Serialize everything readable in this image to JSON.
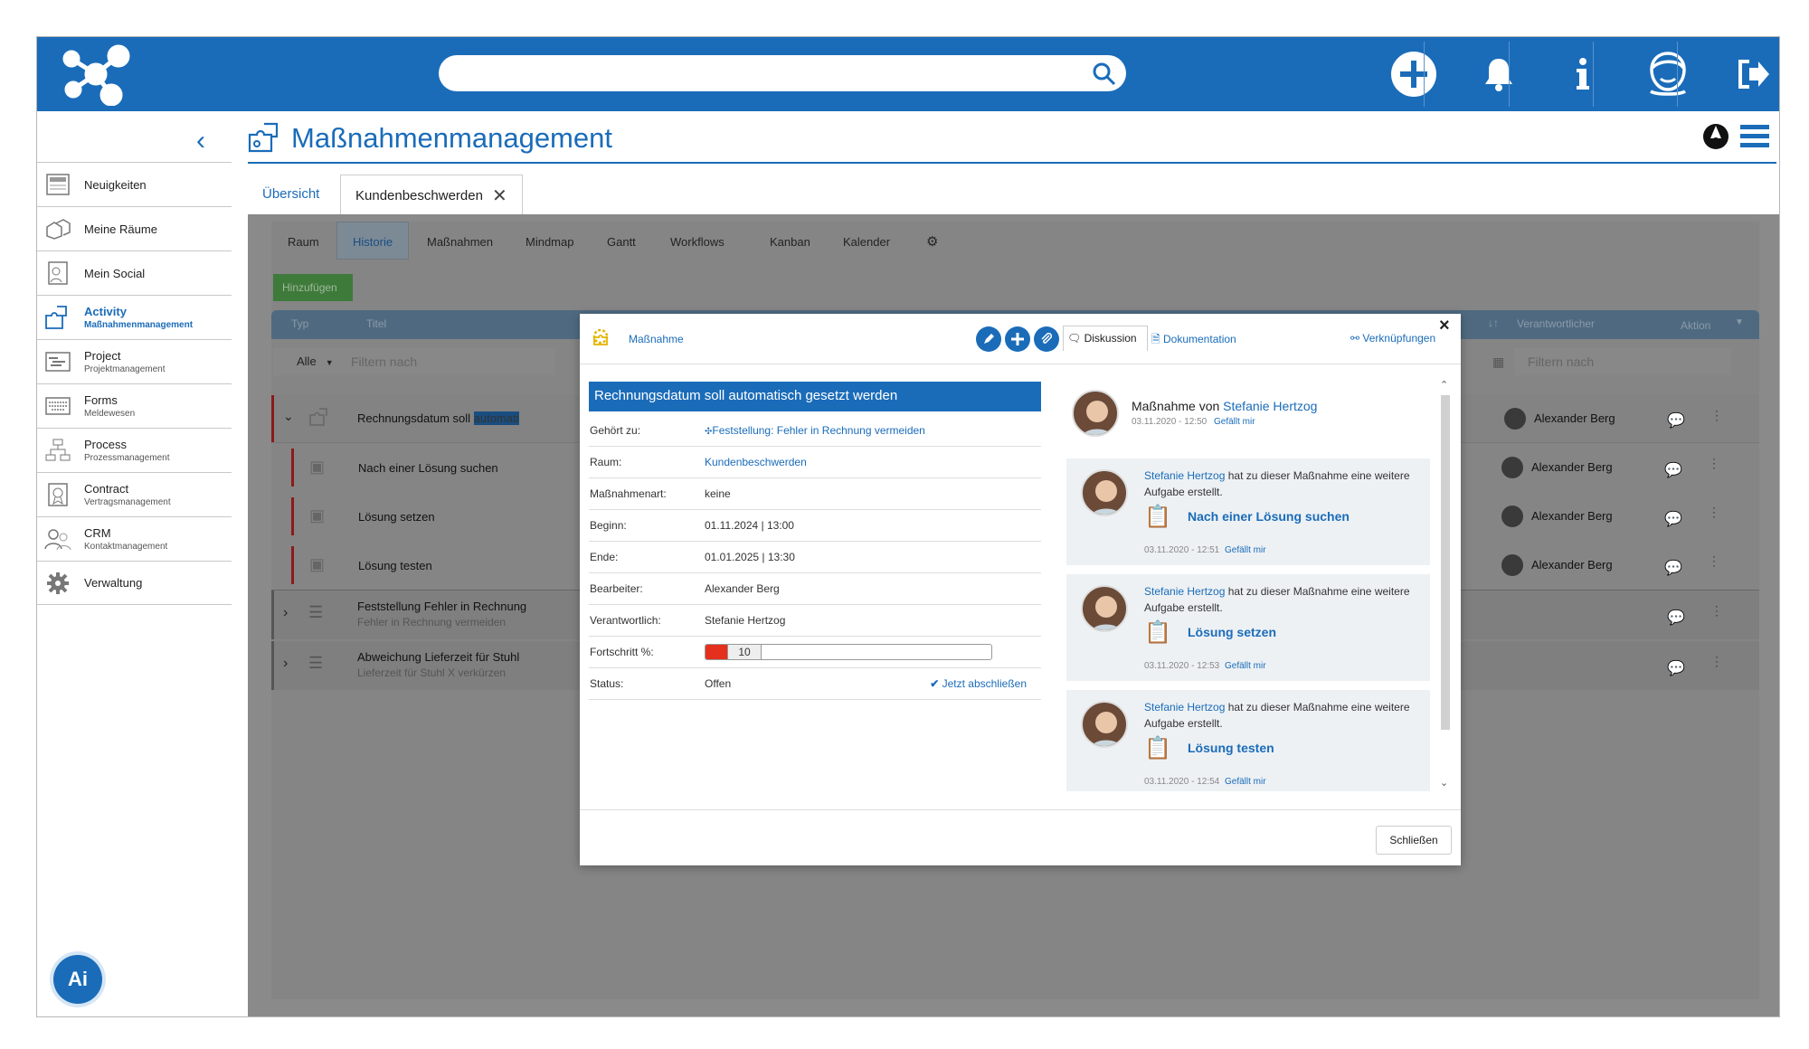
{
  "header": {
    "title": "Maßnahmenmanagement"
  },
  "sidebar": {
    "items": [
      {
        "label": "Neuigkeiten",
        "sub": ""
      },
      {
        "label": "Meine Räume",
        "sub": ""
      },
      {
        "label": "Mein Social",
        "sub": ""
      },
      {
        "label": "Activity",
        "sub": "Maßnahmenmanagement"
      },
      {
        "label": "Project",
        "sub": "Projektmanagement"
      },
      {
        "label": "Forms",
        "sub": "Meldewesen"
      },
      {
        "label": "Process",
        "sub": "Prozessmanagement"
      },
      {
        "label": "Contract",
        "sub": "Vertragsmanagement"
      },
      {
        "label": "CRM",
        "sub": "Kontaktmanagement"
      },
      {
        "label": "Verwaltung",
        "sub": ""
      }
    ],
    "ai_label": "Ai"
  },
  "tabs": {
    "overview": "Übersicht",
    "current": "Kundenbeschwerden"
  },
  "subtabs": [
    "Raum",
    "Historie",
    "Maßnahmen",
    "Mindmap",
    "Gantt",
    "Workflows",
    "Kanban",
    "Kalender"
  ],
  "table": {
    "add_button": "Hinzufügen",
    "col_type": "Typ",
    "col_title": "Titel",
    "col_responsible": "Verantwortlicher",
    "col_action": "Aktion",
    "filter_all": "Alle",
    "filter_placeholder": "Filtern nach",
    "rows": [
      {
        "title": "Rechnungsdatum soll",
        "highlight": "automati",
        "sub": "",
        "responsible": "Alexander Berg"
      },
      {
        "title": "Nach einer Lösung suchen",
        "sub": "",
        "responsible": "Alexander Berg"
      },
      {
        "title": "Lösung setzen",
        "sub": "",
        "responsible": "Alexander Berg"
      },
      {
        "title": "Lösung testen",
        "sub": "",
        "responsible": "Alexander Berg"
      },
      {
        "title": "Feststellung Fehler in Rechnung",
        "sub": "Fehler in Rechnung vermeiden",
        "responsible": ""
      },
      {
        "title": "Abweichung Lieferzeit für Stuhl",
        "sub": "Lieferzeit für Stuhl X verkürzen",
        "responsible": ""
      }
    ]
  },
  "modal": {
    "type_label": "Maßnahme",
    "tab_discussion": "Diskussion",
    "tab_documentation": "Dokumentation",
    "links_label": "Verknüpfungen",
    "close_x": "×",
    "title": "Rechnungsdatum soll automatisch gesetzt werden",
    "fields": [
      {
        "label": "Gehört zu:",
        "value": "Feststellung: Fehler in Rechnung vermeiden"
      },
      {
        "label": "Raum:",
        "value": "Kundenbeschwerden"
      },
      {
        "label": "Maßnahmenart:",
        "value": "keine"
      },
      {
        "label": "Beginn:",
        "value": "01.11.2024 | 13:00"
      },
      {
        "label": "Ende:",
        "value": "01.01.2025 | 13:30"
      },
      {
        "label": "Bearbeiter:",
        "value": "Alexander Berg"
      },
      {
        "label": "Verantwortlich:",
        "value": "Stefanie Hertzog"
      }
    ],
    "progress": {
      "label": "Fortschritt %:",
      "value": 10,
      "value_text": "10"
    },
    "status": {
      "label": "Status:",
      "value": "Offen",
      "action": "Jetzt abschließen"
    },
    "discussion": {
      "main": {
        "prefix": "Maßnahme von ",
        "author": "Stefanie Hertzog",
        "time": "03.11.2020 - 12:50",
        "like": "Gefällt mir"
      },
      "posts": [
        {
          "author": "Stefanie Hertzog",
          "text": " hat zu dieser Maßnahme eine weitere Aufgabe erstellt.",
          "task": "Nach einer Lösung suchen",
          "time": "03.11.2020 - 12:51",
          "like": "Gefällt mir"
        },
        {
          "author": "Stefanie Hertzog",
          "text": " hat zu dieser Maßnahme eine weitere Aufgabe erstellt.",
          "task": "Lösung setzen",
          "time": "03.11.2020 - 12:53",
          "like": "Gefällt mir"
        },
        {
          "author": "Stefanie Hertzog",
          "text": " hat zu dieser Maßnahme eine weitere Aufgabe erstellt.",
          "task": "Lösung testen",
          "time": "03.11.2020 - 12:54",
          "like": "Gefällt mir"
        }
      ]
    },
    "close_button": "Schließen"
  }
}
